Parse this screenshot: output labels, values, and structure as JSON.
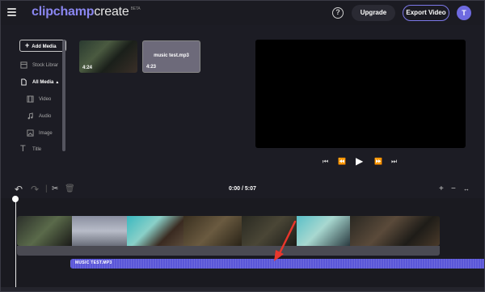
{
  "header": {
    "logo_part1": "clipchamp",
    "logo_part2": "create",
    "logo_badge": "BETA",
    "help_label": "?",
    "upgrade_label": "Upgrade",
    "export_label": "Export Video",
    "avatar_initial": "T",
    "accent_color": "#7c78e8"
  },
  "sidebar": {
    "add_media_label": "Add Media",
    "items": [
      {
        "label": "Stock Librar",
        "icon": "library-icon"
      },
      {
        "label": "All Media",
        "icon": "file-icon",
        "active": true
      },
      {
        "label": "Video",
        "icon": "film-icon"
      },
      {
        "label": "Audio",
        "icon": "music-note-icon"
      },
      {
        "label": "Image",
        "icon": "image-icon"
      },
      {
        "label": "Title",
        "icon": "text-icon"
      }
    ]
  },
  "media": [
    {
      "type": "video",
      "duration": "4:24",
      "name": ""
    },
    {
      "type": "audio",
      "duration": "4:23",
      "name": "music test.mp3"
    }
  ],
  "player": {
    "controls": [
      "skip-back-icon",
      "rewind-icon",
      "play-icon",
      "fast-forward-icon",
      "skip-forward-icon"
    ]
  },
  "timeline": {
    "time_display": "0:00 / 5:07",
    "audio_clip_label": "MUSIC TEST.MP3",
    "audio_color": "#5a56d8"
  }
}
